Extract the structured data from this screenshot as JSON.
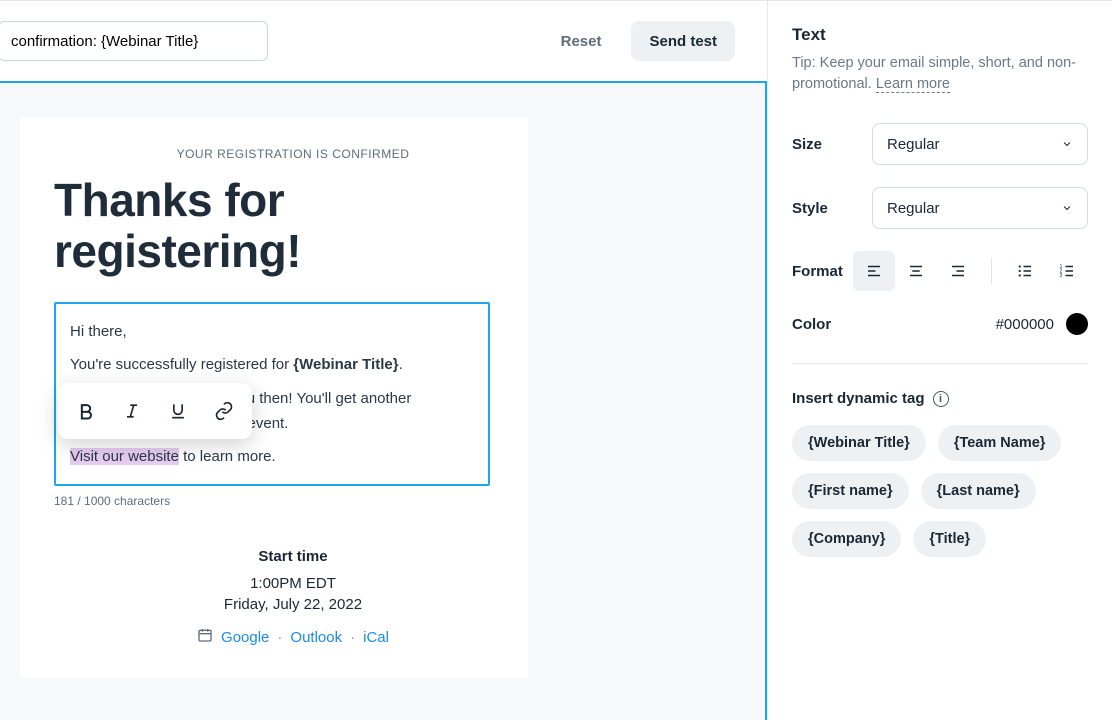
{
  "topbar": {
    "subject_value": "confirmation: {Webinar Title}",
    "reset_label": "Reset",
    "send_label": "Send test"
  },
  "email": {
    "eyebrow": "YOUR REGISTRATION IS CONFIRMED",
    "headline": "Thanks for registering!",
    "p1": "Hi there,",
    "p2a": "You're successfully registered for ",
    "p2b": "{Webinar Title}",
    "p2c": ".",
    "p3_tail": "ng you then! You'll get another",
    "p4_tail": "e the event.",
    "p5_link": "Visit our website",
    "p5_tail": " to learn more.",
    "char_count": "181 / 1000 characters",
    "start_time_label": "Start time",
    "time": "1:00PM EDT",
    "date": "Friday, July 22, 2022",
    "cal_google": "Google",
    "cal_outlook": "Outlook",
    "cal_ical": "iCal"
  },
  "panel": {
    "title": "Text",
    "tip_a": "Tip: Keep your email simple, short, and non-promotional. ",
    "tip_link": "Learn more",
    "size_label": "Size",
    "size_value": "Regular",
    "style_label": "Style",
    "style_value": "Regular",
    "format_label": "Format",
    "color_label": "Color",
    "color_value": "#000000",
    "dyn_label": "Insert dynamic tag",
    "tags": {
      "t1": "{Webinar Title}",
      "t2": "{Team Name}",
      "t3": "{First name}",
      "t4": "{Last name}",
      "t5": "{Company}",
      "t6": "{Title}"
    }
  }
}
